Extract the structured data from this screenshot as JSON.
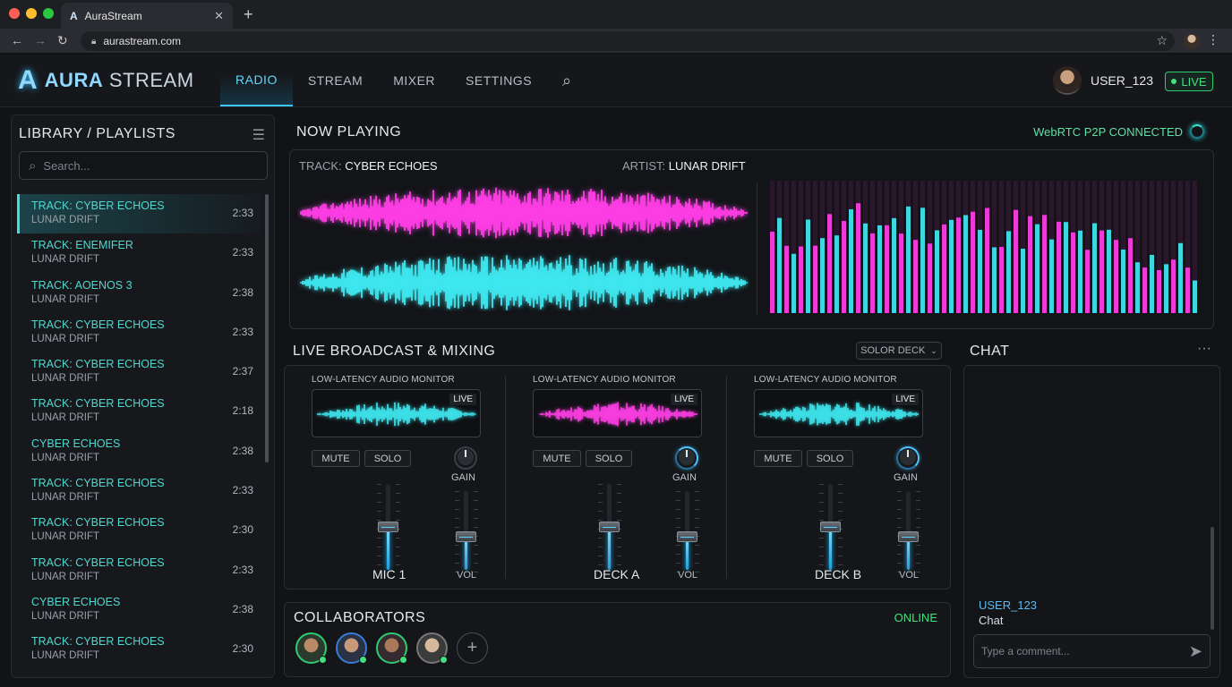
{
  "browser": {
    "tab_title": "AuraStream",
    "tab_icon": "A",
    "url": "aurastream.com"
  },
  "app": {
    "logo_mark": "A",
    "logo_word1": "AURA",
    "logo_word2": " STREAM",
    "nav": [
      "RADIO",
      "STREAM",
      "MIXER",
      "SETTINGS"
    ],
    "active_nav": "RADIO",
    "user": "USER_123",
    "live_label": "LIVE"
  },
  "library": {
    "title": "LIBRARY / PLAYLISTS",
    "search_placeholder": "Search...",
    "items": [
      {
        "track": "TRACK: CYBER ECHOES",
        "artist": "LUNAR DRIFT",
        "duration": "2:33"
      },
      {
        "track": "TRACK: ENEMIFER",
        "artist": "LUNAR DRIFT",
        "duration": "2:33"
      },
      {
        "track": "TRACK: AOENOS 3",
        "artist": "LUNAR DRIFT",
        "duration": "2:38"
      },
      {
        "track": "TRACK: CYBER ECHOES",
        "artist": "LUNAR DRIFT",
        "duration": "2:33"
      },
      {
        "track": "TRACK: CYBER ECHOES",
        "artist": "LUNAR DRIFT",
        "duration": "2:37"
      },
      {
        "track": "TRACK: CYBER ECHOES",
        "artist": "LUNAR DRIFT",
        "duration": "2:18"
      },
      {
        "track": "CYBER ECHOES",
        "artist": "LUNAR DRIFT",
        "duration": "2:38"
      },
      {
        "track": "TRACK: CYBER ECHOES",
        "artist": "LUNAR DRIFT",
        "duration": "2:33"
      },
      {
        "track": "TRACK: CYBER ECHOES",
        "artist": "LUNAR DRIFT",
        "duration": "2:30"
      },
      {
        "track": "TRACK: CYBER ECHOES",
        "artist": "LUNAR DRIFT",
        "duration": "2:33"
      },
      {
        "track": "CYBER ECHOES",
        "artist": "LUNAR DRIFT",
        "duration": "2:38"
      },
      {
        "track": "TRACK: CYBER ECHOES",
        "artist": "LUNAR DRIFT",
        "duration": "2:30"
      }
    ]
  },
  "now_playing": {
    "title": "NOW PLAYING",
    "connection": "WebRTC P2P CONNECTED",
    "track_label": "TRACK: ",
    "track": "CYBER ECHOES",
    "artist_label": "ARTIST: ",
    "artist": "LUNAR DRIFT"
  },
  "mixing": {
    "title": "LIVE BROADCAST & MIXING",
    "deck_select": "SOLOR DECK",
    "channels": [
      {
        "monitor_label": "LOW-LATENCY AUDIO MONITOR",
        "live": "LIVE",
        "mute": "MUTE",
        "solo": "SOLO",
        "gain": "GAIN",
        "name": "MIC 1",
        "vol": "VOL",
        "main_level": 0.5,
        "vol_level": 0.42,
        "wave_color": "#3fe8f0"
      },
      {
        "monitor_label": "LOW-LATENCY AUDIO MONITOR",
        "live": "LIVE",
        "mute": "MUTE",
        "solo": "SOLO",
        "gain": "GAIN",
        "name": "DECK A",
        "vol": "VOL",
        "main_level": 0.5,
        "vol_level": 0.42,
        "wave_color": "#ff3ee6"
      },
      {
        "monitor_label": "LOW-LATENCY AUDIO MONITOR",
        "live": "LIVE",
        "mute": "MUTE",
        "solo": "SOLO",
        "gain": "GAIN",
        "name": "DECK B",
        "vol": "VOL",
        "main_level": 0.5,
        "vol_level": 0.42,
        "wave_color": "#3fe8f0"
      }
    ]
  },
  "collaborators": {
    "title": "COLLABORATORS",
    "status": "ONLINE",
    "add": "+"
  },
  "chat": {
    "title": "CHAT",
    "more": "···",
    "user": "USER_123",
    "message": "Chat",
    "placeholder": "Type a comment..."
  },
  "colors": {
    "accent": "#3ec8ff",
    "teal": "#4fd8cf",
    "magenta": "#ff3ee6",
    "online": "#43e080"
  }
}
